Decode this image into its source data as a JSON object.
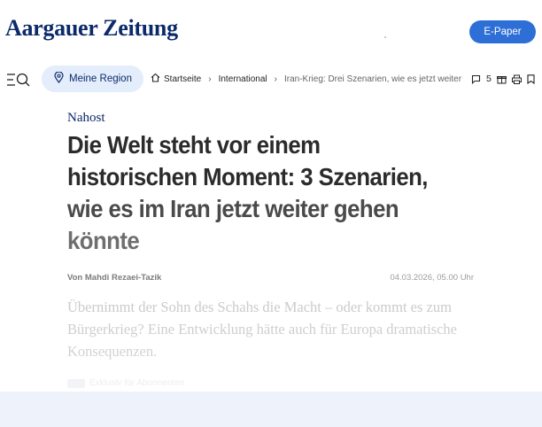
{
  "header": {
    "logo": "Aargauer Zeitung",
    "epaper_label": "E-Paper"
  },
  "nav": {
    "menu_icon": "menu-search-icon",
    "region_label": "Meine Region",
    "region_icon": "location-pin-icon",
    "breadcrumbs": [
      "Startseite",
      "International",
      "Iran-Krieg: Drei Szenarien, wie es jetzt weiter"
    ],
    "comment_count": "5",
    "tool_icons": [
      "comment-icon",
      "gift-icon",
      "print-icon",
      "bookmark-icon"
    ]
  },
  "article": {
    "kicker": "Nahost",
    "headline_lines": [
      "Die Welt steht vor einem",
      "historischen Moment: 3 Szenarien,",
      "wie es im Iran jetzt weiter gehen",
      "könnte"
    ],
    "author": "Von Mahdi Rezaei-Tazik",
    "date": "04.03.2026, 05.00 Uhr",
    "lead": "Übernimmt der Sohn des Schahs die Macht – oder kommt es zum Bürgerkrieg? Eine Entwicklung hätte auch für Europa dramatische Konsequenzen.",
    "exclusive": "Exklusiv für Abonnenten"
  },
  "colors": {
    "brand": "#0b2a6b",
    "epaper_bg": "#2d6fd6",
    "region_bg": "#e4edfb",
    "bottom_band": "#eef3fb"
  }
}
